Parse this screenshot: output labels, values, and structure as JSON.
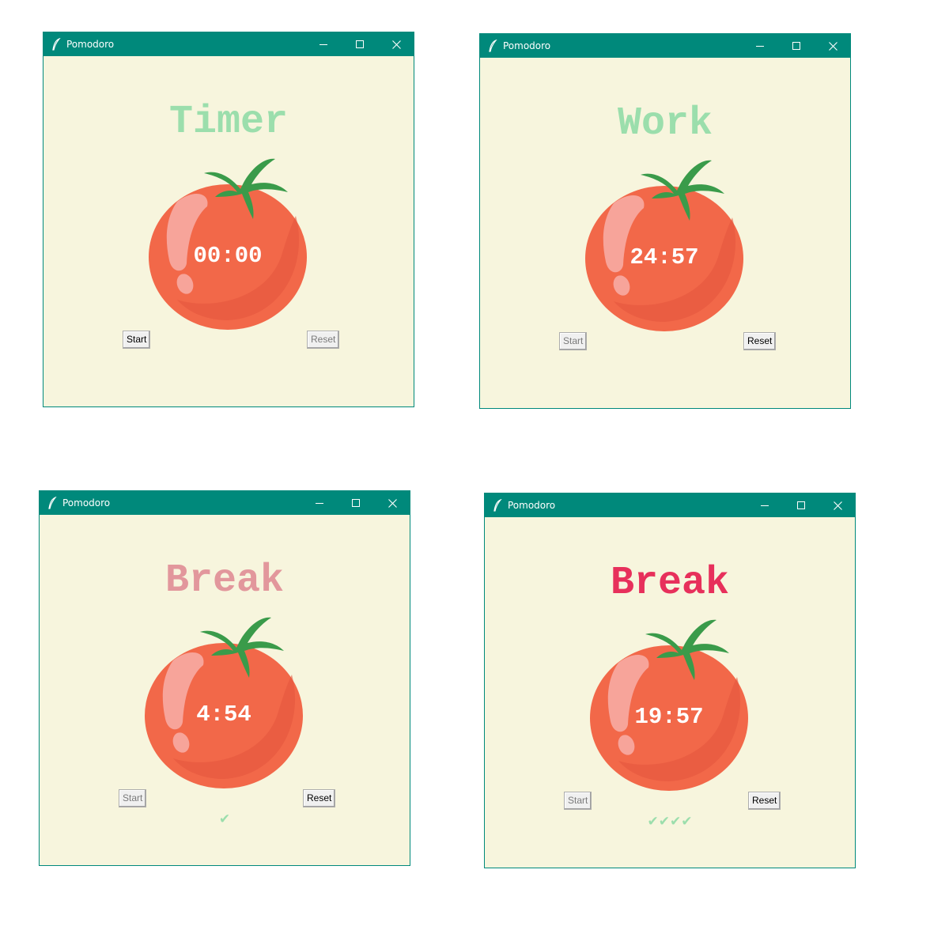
{
  "app": {
    "window_title": "Pomodoro"
  },
  "colors": {
    "titlebar": "#00897b",
    "background": "#f7f5dd",
    "green_label": "#9bdeac",
    "pink_label": "#e2979c",
    "red_label": "#e7305b",
    "timer_text": "#ffffff",
    "check_color": "#9bdeac"
  },
  "icons": {
    "app_icon": "feather-icon",
    "minimize": "minimize-icon",
    "maximize": "maximize-icon",
    "close": "close-icon",
    "tomato": "tomato-image"
  },
  "windows": [
    {
      "title": "Pomodoro",
      "heading": "Timer",
      "heading_color": "#9bdeac",
      "timer": "00:00",
      "start_label": "Start",
      "reset_label": "Reset",
      "start_enabled": true,
      "reset_enabled": false,
      "checkmarks": ""
    },
    {
      "title": "Pomodoro",
      "heading": "Work",
      "heading_color": "#9bdeac",
      "timer": "24:57",
      "start_label": "Start",
      "reset_label": "Reset",
      "start_enabled": false,
      "reset_enabled": true,
      "checkmarks": ""
    },
    {
      "title": "Pomodoro",
      "heading": "Break",
      "heading_color": "#e2979c",
      "timer": "4:54",
      "start_label": "Start",
      "reset_label": "Reset",
      "start_enabled": false,
      "reset_enabled": true,
      "checkmarks": "✔"
    },
    {
      "title": "Pomodoro",
      "heading": "Break",
      "heading_color": "#e7305b",
      "timer": "19:57",
      "start_label": "Start",
      "reset_label": "Reset",
      "start_enabled": false,
      "reset_enabled": true,
      "checkmarks": "✔✔✔✔"
    }
  ]
}
